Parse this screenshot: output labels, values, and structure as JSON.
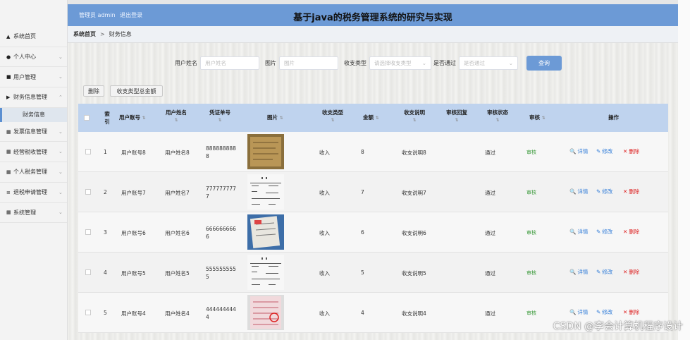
{
  "header": {
    "admin_label": "管理员 admin",
    "logout_label": "退出登录",
    "title": "基于java的税务管理系统的研究与实现"
  },
  "sidebar": {
    "items": [
      {
        "label": "系统首页",
        "icon": "home-icon",
        "glyph": "▲",
        "chev": ""
      },
      {
        "label": "个人中心",
        "icon": "user-icon",
        "glyph": "●",
        "chev": "⌄"
      },
      {
        "label": "用户管理",
        "icon": "chat-icon",
        "glyph": "■",
        "chev": "⌄"
      },
      {
        "label": "财务信息管理",
        "icon": "flag-icon",
        "glyph": "▶",
        "chev": "⌃"
      },
      {
        "label": "发票信息管理",
        "icon": "grid-icon",
        "glyph": "▦",
        "chev": "⌄"
      },
      {
        "label": "经营税收管理",
        "icon": "grid-icon",
        "glyph": "▦",
        "chev": "⌄"
      },
      {
        "label": "个人税务管理",
        "icon": "grid-icon",
        "glyph": "▦",
        "chev": "⌄"
      },
      {
        "label": "退税申请管理",
        "icon": "list-icon",
        "glyph": "≡",
        "chev": "⌄"
      },
      {
        "label": "系统管理",
        "icon": "grid-icon",
        "glyph": "▦",
        "chev": "⌄"
      }
    ],
    "sub_item": "财务信息"
  },
  "breadcrumb": {
    "home": "系统首页",
    "separator": ">",
    "current": "财务信息"
  },
  "search": {
    "username_label": "用户姓名",
    "username_placeholder": "用户姓名",
    "image_label": "图片",
    "image_placeholder": "图片",
    "type_label": "收支类型",
    "type_placeholder": "请选择收支类型",
    "audit_label": "是否通过",
    "audit_placeholder": "是否通过",
    "query_label": "查询"
  },
  "actions": {
    "delete_label": "删除",
    "total_label": "收支类型总金额"
  },
  "table": {
    "headers": {
      "index": "索引",
      "account": "用户账号",
      "username": "用户姓名",
      "voucher": "凭证单号",
      "image": "图片",
      "type": "收支类型",
      "amount": "金额",
      "desc": "收支说明",
      "reply": "审核回复",
      "status": "审核状态",
      "audit": "审核",
      "ops": "操作"
    },
    "rows": [
      {
        "index": "1",
        "account": "用户账号8",
        "username": "用户姓名8",
        "voucher_a": "888888888",
        "voucher_b": "8",
        "type": "收入",
        "amount": "8",
        "desc": "收支说明8",
        "status": "通过",
        "audit": "审核",
        "img": "doc-brown"
      },
      {
        "index": "2",
        "account": "用户账号7",
        "username": "用户姓名7",
        "voucher_a": "777777777",
        "voucher_b": "7",
        "type": "收入",
        "amount": "7",
        "desc": "收支说明7",
        "status": "通过",
        "audit": "审核",
        "img": "doc-white"
      },
      {
        "index": "3",
        "account": "用户账号6",
        "username": "用户姓名6",
        "voucher_a": "666666666",
        "voucher_b": "6",
        "type": "收入",
        "amount": "6",
        "desc": "收支说明6",
        "status": "通过",
        "audit": "审核",
        "img": "doc-blue"
      },
      {
        "index": "4",
        "account": "用户账号5",
        "username": "用户姓名5",
        "voucher_a": "555555555",
        "voucher_b": "5",
        "type": "收入",
        "amount": "5",
        "desc": "收支说明5",
        "status": "通过",
        "audit": "审核",
        "img": "doc-white"
      },
      {
        "index": "5",
        "account": "用户账号4",
        "username": "用户姓名4",
        "voucher_a": "444444444",
        "voucher_b": "4",
        "type": "收入",
        "amount": "4",
        "desc": "收支说明4",
        "status": "通过",
        "audit": "审核",
        "img": "doc-pink"
      }
    ],
    "ops": {
      "detail": "详情",
      "edit": "修改",
      "delete": "删除"
    }
  },
  "watermark": "CSDN @李会计算机程序设计"
}
